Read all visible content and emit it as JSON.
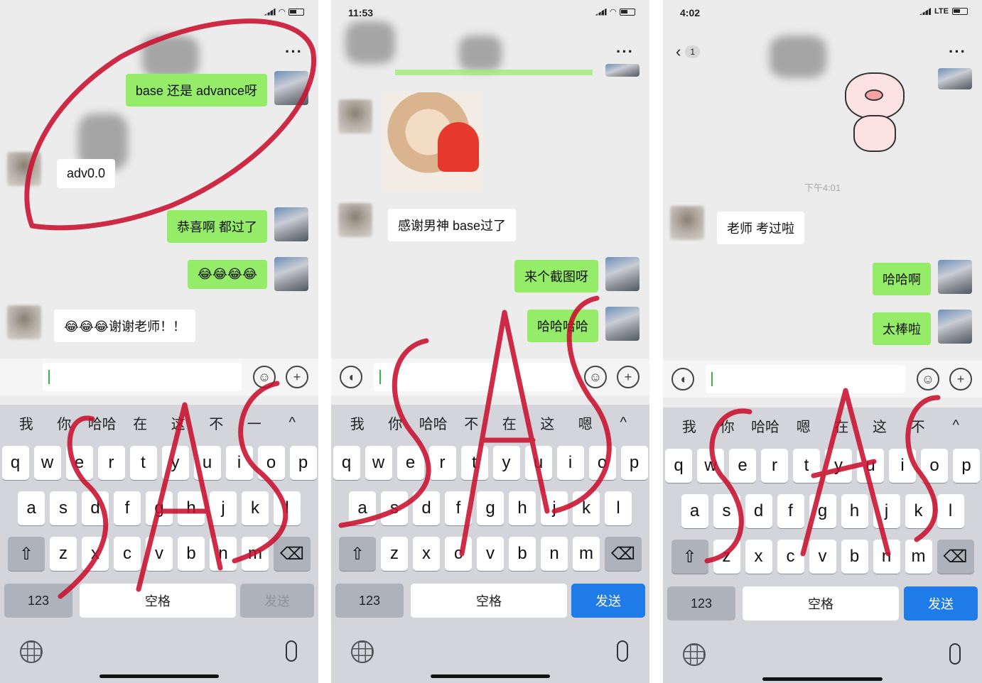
{
  "panels": [
    {
      "status_time": "",
      "status_right": "",
      "back_badge": "",
      "messages": {
        "m1": "base 还是 advance呀",
        "m2": "adv0.0",
        "m3": "恭喜啊 都过了",
        "m4": "😂😂😂😂",
        "m5": "😂😂😂谢谢老师！！"
      },
      "candidates": [
        "我",
        "你",
        "哈哈",
        "在",
        "这",
        "不",
        "一",
        "^"
      ],
      "send_label": "发送",
      "send_active": false
    },
    {
      "status_time": "11:53",
      "status_right": "",
      "messages": {
        "m1": "感谢男神 base过了",
        "m2": "来个截图呀",
        "m3": "哈哈哈哈"
      },
      "candidates": [
        "我",
        "你",
        "哈哈",
        "不",
        "在",
        "这",
        "嗯",
        "^"
      ],
      "send_label": "发送",
      "send_active": true
    },
    {
      "status_time": "4:02",
      "status_right": "LTE",
      "back_badge": "1",
      "timestamp": "下午4:01",
      "messages": {
        "m1": "老师 考过啦",
        "m2": "哈哈啊",
        "m3": "太棒啦"
      },
      "candidates": [
        "我",
        "你",
        "哈哈",
        "嗯",
        "在",
        "这",
        "不",
        "^"
      ],
      "send_label": "发送",
      "send_active": true
    }
  ],
  "keyboard": {
    "row1": [
      "q",
      "w",
      "e",
      "r",
      "t",
      "y",
      "u",
      "i",
      "o",
      "p"
    ],
    "row2": [
      "a",
      "s",
      "d",
      "f",
      "g",
      "h",
      "j",
      "k",
      "l"
    ],
    "row3": [
      "z",
      "x",
      "c",
      "v",
      "b",
      "n",
      "m"
    ],
    "num_label": "123",
    "space_label": "空格"
  },
  "colors": {
    "sent_bubble": "#95ec69",
    "received_bubble": "#ffffff",
    "send_active": "#1f7be8",
    "annotation_red": "#c8102e"
  },
  "annotation_text": "SAS"
}
